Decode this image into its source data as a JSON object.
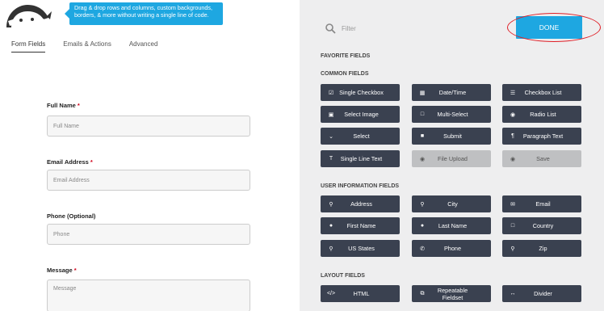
{
  "tooltip": "Drag & drop rows and columns, custom backgrounds, borders, & more without writing a single line of code.",
  "tabs": [
    {
      "label": "Form Fields"
    },
    {
      "label": "Emails & Actions"
    },
    {
      "label": "Advanced"
    }
  ],
  "form": {
    "full_name": {
      "label": "Full Name",
      "req": "*",
      "placeholder": "Full Name"
    },
    "email": {
      "label": "Email Address",
      "req": "*",
      "placeholder": "Email Address"
    },
    "phone": {
      "label": "Phone (Optional)",
      "placeholder": "Phone"
    },
    "message": {
      "label": "Message",
      "req": "*",
      "placeholder": "Message"
    }
  },
  "filter": {
    "placeholder": "Filter"
  },
  "done_label": "DONE",
  "sections": {
    "favorite": "FAVORITE FIELDS",
    "common": "COMMON FIELDS",
    "user_info": "USER INFORMATION FIELDS",
    "layout": "LAYOUT FIELDS"
  },
  "common_fields": [
    {
      "label": "Single Checkbox",
      "icon": "checkbox-icon"
    },
    {
      "label": "Date/Time",
      "icon": "calendar-icon"
    },
    {
      "label": "Checkbox List",
      "icon": "list-icon"
    },
    {
      "label": "Select Image",
      "icon": "image-icon"
    },
    {
      "label": "Multi-Select",
      "icon": "square-icon"
    },
    {
      "label": "Radio List",
      "icon": "radio-icon"
    },
    {
      "label": "Select",
      "icon": "chevron-down-icon"
    },
    {
      "label": "Submit",
      "icon": "square-filled-icon"
    },
    {
      "label": "Paragraph Text",
      "icon": "paragraph-icon"
    },
    {
      "label": "Single Line Text",
      "icon": "text-icon"
    },
    {
      "label": "File Upload",
      "icon": "upload-icon"
    },
    {
      "label": "Save",
      "icon": "save-icon"
    }
  ],
  "user_fields": [
    {
      "label": "Address",
      "icon": "map-pin-icon"
    },
    {
      "label": "City",
      "icon": "map-pin-icon"
    },
    {
      "label": "Email",
      "icon": "envelope-icon"
    },
    {
      "label": "First Name",
      "icon": "user-icon"
    },
    {
      "label": "Last Name",
      "icon": "user-icon"
    },
    {
      "label": "Country",
      "icon": "square-icon"
    },
    {
      "label": "US States",
      "icon": "map-pin-icon"
    },
    {
      "label": "Phone",
      "icon": "phone-icon"
    },
    {
      "label": "Zip",
      "icon": "map-pin-icon"
    }
  ],
  "layout_fields": [
    {
      "label": "HTML",
      "icon": "code-icon"
    },
    {
      "label": "Repeatable Fieldset",
      "icon": "copy-icon"
    },
    {
      "label": "Divider",
      "icon": "divider-icon"
    }
  ],
  "colors": {
    "accent": "#1ea7e1",
    "button_dark": "#3a4150",
    "button_disabled": "#bfc0c2",
    "highlight": "#e01e26"
  }
}
